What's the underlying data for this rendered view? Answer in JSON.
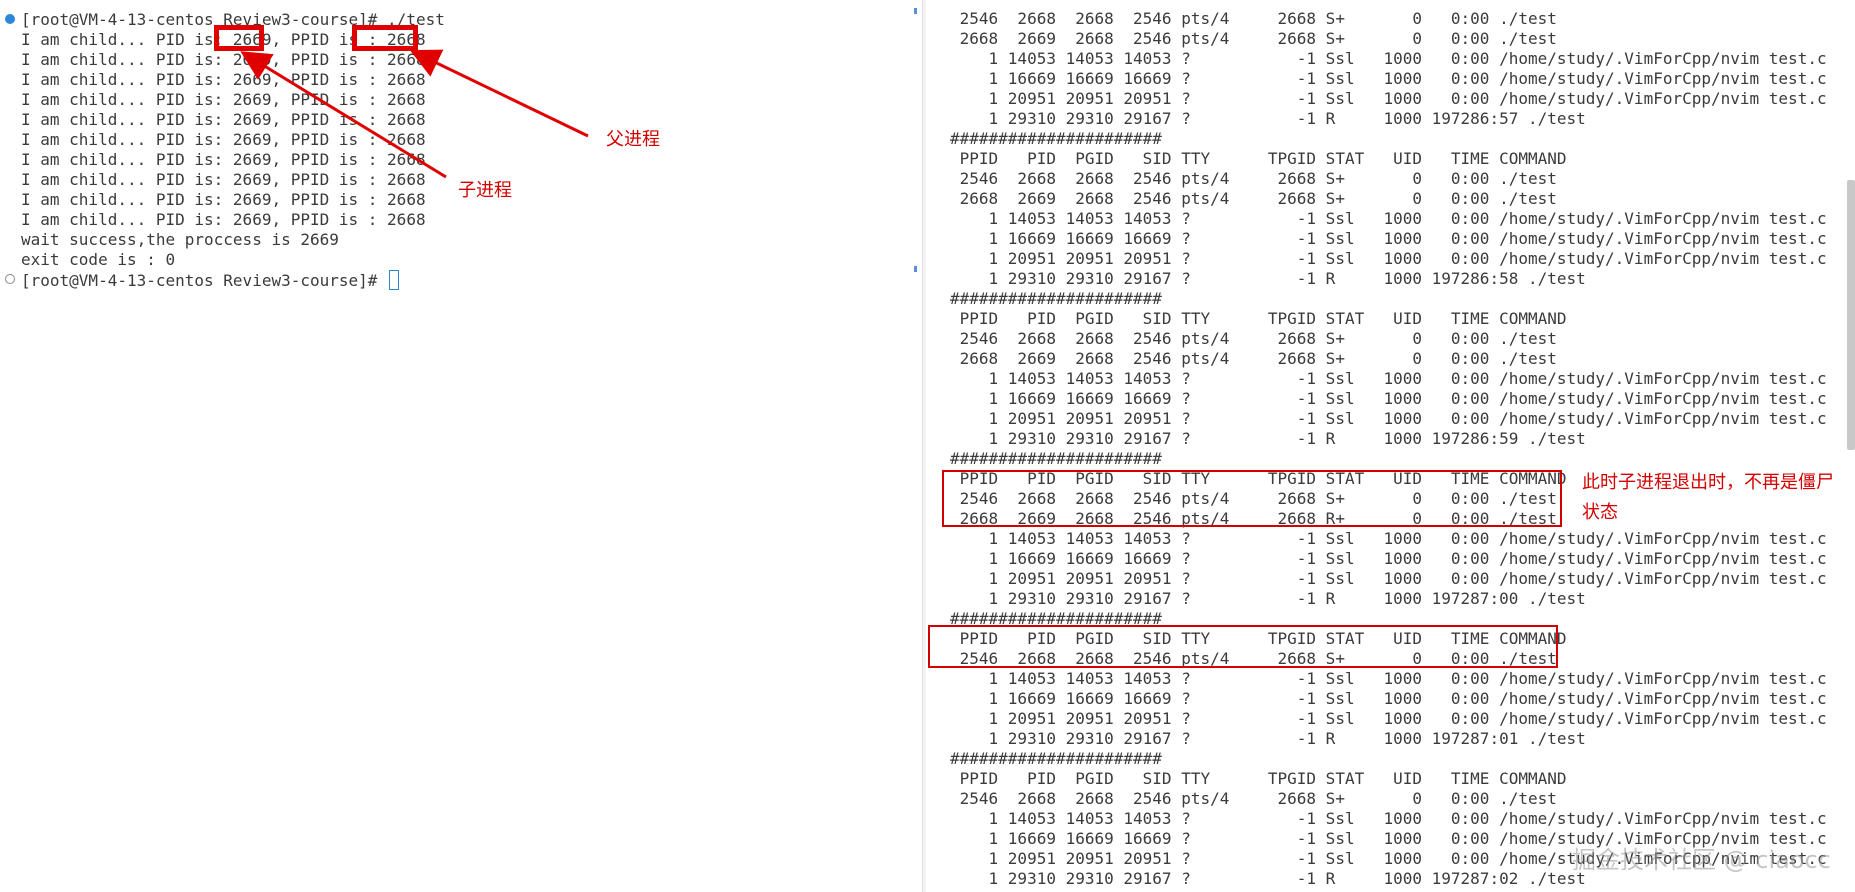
{
  "left_terminal": {
    "lines": [
      "[root@VM-4-13-centos Review3-course]# ./test",
      "I am child... PID is: 2669, PPID is : 2668",
      "I am child... PID is: 2669, PPID is : 2668",
      "I am child... PID is: 2669, PPID is : 2668",
      "I am child... PID is: 2669, PPID is : 2668",
      "I am child... PID is: 2669, PPID is : 2668",
      "I am child... PID is: 2669, PPID is : 2668",
      "I am child... PID is: 2669, PPID is : 2668",
      "I am child... PID is: 2669, PPID is : 2668",
      "I am child... PID is: 2669, PPID is : 2668",
      "I am child... PID is: 2669, PPID is : 2668",
      "wait success,the proccess is 2669",
      "exit code is : 0",
      "[root@VM-4-13-centos Review3-course]# "
    ]
  },
  "right_terminal": {
    "lines": [
      " 2546  2668  2668  2546 pts/4     2668 S+       0   0:00 ./test",
      " 2668  2669  2668  2546 pts/4     2668 S+       0   0:00 ./test",
      "    1 14053 14053 14053 ?           -1 Ssl   1000   0:00 /home/study/.VimForCpp/nvim test.c",
      "    1 16669 16669 16669 ?           -1 Ssl   1000   0:00 /home/study/.VimForCpp/nvim test.c",
      "    1 20951 20951 20951 ?           -1 Ssl   1000   0:00 /home/study/.VimForCpp/nvim test.c",
      "    1 29310 29310 29167 ?           -1 R     1000 197286:57 ./test",
      "######################",
      " PPID   PID  PGID   SID TTY      TPGID STAT   UID   TIME COMMAND",
      " 2546  2668  2668  2546 pts/4     2668 S+       0   0:00 ./test",
      " 2668  2669  2668  2546 pts/4     2668 S+       0   0:00 ./test",
      "    1 14053 14053 14053 ?           -1 Ssl   1000   0:00 /home/study/.VimForCpp/nvim test.c",
      "    1 16669 16669 16669 ?           -1 Ssl   1000   0:00 /home/study/.VimForCpp/nvim test.c",
      "    1 20951 20951 20951 ?           -1 Ssl   1000   0:00 /home/study/.VimForCpp/nvim test.c",
      "    1 29310 29310 29167 ?           -1 R     1000 197286:58 ./test",
      "######################",
      " PPID   PID  PGID   SID TTY      TPGID STAT   UID   TIME COMMAND",
      " 2546  2668  2668  2546 pts/4     2668 S+       0   0:00 ./test",
      " 2668  2669  2668  2546 pts/4     2668 S+       0   0:00 ./test",
      "    1 14053 14053 14053 ?           -1 Ssl   1000   0:00 /home/study/.VimForCpp/nvim test.c",
      "    1 16669 16669 16669 ?           -1 Ssl   1000   0:00 /home/study/.VimForCpp/nvim test.c",
      "    1 20951 20951 20951 ?           -1 Ssl   1000   0:00 /home/study/.VimForCpp/nvim test.c",
      "    1 29310 29310 29167 ?           -1 R     1000 197286:59 ./test",
      "######################",
      " PPID   PID  PGID   SID TTY      TPGID STAT   UID   TIME COMMAND",
      " 2546  2668  2668  2546 pts/4     2668 S+       0   0:00 ./test",
      " 2668  2669  2668  2546 pts/4     2668 R+       0   0:00 ./test",
      "    1 14053 14053 14053 ?           -1 Ssl   1000   0:00 /home/study/.VimForCpp/nvim test.c",
      "    1 16669 16669 16669 ?           -1 Ssl   1000   0:00 /home/study/.VimForCpp/nvim test.c",
      "    1 20951 20951 20951 ?           -1 Ssl   1000   0:00 /home/study/.VimForCpp/nvim test.c",
      "    1 29310 29310 29167 ?           -1 R     1000 197287:00 ./test",
      "######################",
      " PPID   PID  PGID   SID TTY      TPGID STAT   UID   TIME COMMAND",
      " 2546  2668  2668  2546 pts/4     2668 S+       0   0:00 ./test",
      "    1 14053 14053 14053 ?           -1 Ssl   1000   0:00 /home/study/.VimForCpp/nvim test.c",
      "    1 16669 16669 16669 ?           -1 Ssl   1000   0:00 /home/study/.VimForCpp/nvim test.c",
      "    1 20951 20951 20951 ?           -1 Ssl   1000   0:00 /home/study/.VimForCpp/nvim test.c",
      "    1 29310 29310 29167 ?           -1 R     1000 197287:01 ./test",
      "######################",
      " PPID   PID  PGID   SID TTY      TPGID STAT   UID   TIME COMMAND",
      " 2546  2668  2668  2546 pts/4     2668 S+       0   0:00 ./test",
      "    1 14053 14053 14053 ?           -1 Ssl   1000   0:00 /home/study/.VimForCpp/nvim test.c",
      "    1 16669 16669 16669 ?           -1 Ssl   1000   0:00 /home/study/.VimForCpp/nvim test.c",
      "    1 20951 20951 20951 ?           -1 Ssl   1000   0:00 /home/study/.VimForCpp/nvim test.c",
      "    1 29310 29310 29167 ?           -1 R     1000 197287:02 ./test"
    ]
  },
  "annotations": {
    "parent_label": "父进程",
    "child_label": "子进程",
    "zombie_note": "此时子进程退出时，不再是僵尸状态"
  },
  "watermark": "掘金技术社区 @ ciaocc",
  "colors": {
    "annotation_red": "#e00000",
    "terminal_text": "#3b3b3b",
    "status_blue": "#2b88d8"
  }
}
